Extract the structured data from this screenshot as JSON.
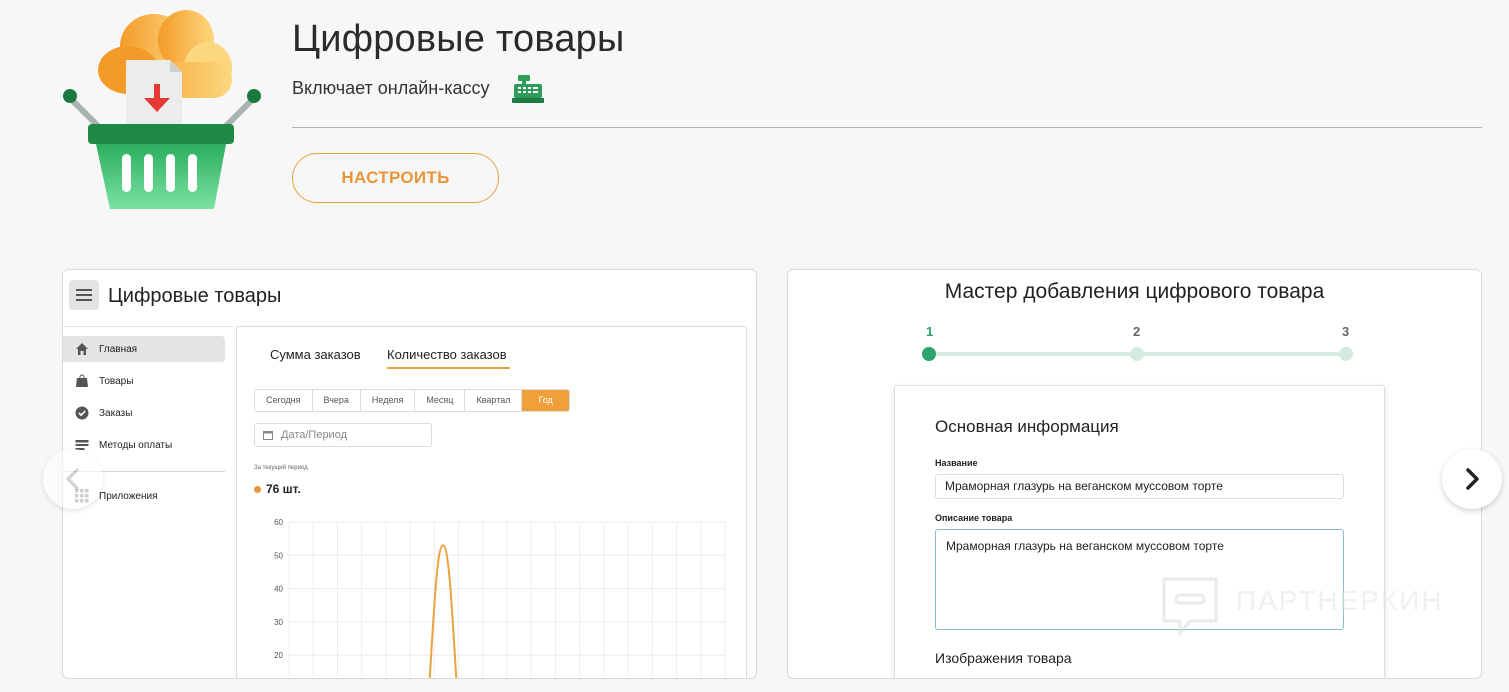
{
  "header": {
    "title": "Цифровые товары",
    "subtitle": "Включает онлайн-кассу",
    "configure_button": "НАСТРОИТЬ",
    "logo_icon": "basket-download-cloud-icon",
    "register_icon": "cash-register-icon",
    "accent_color": "#e8963b"
  },
  "screenshot_1": {
    "title": "Цифровые товары",
    "nav": [
      {
        "label": "Главная",
        "icon": "home-icon",
        "active": true
      },
      {
        "label": "Товары",
        "icon": "bag-icon"
      },
      {
        "label": "Заказы",
        "icon": "check-circle-icon"
      },
      {
        "label": "Методы оплаты",
        "icon": "card-icon"
      }
    ],
    "apps_label": "Приложения",
    "tabs": [
      "Сумма заказов",
      "Количество заказов"
    ],
    "active_tab": "Количество заказов",
    "periods": [
      "Сегодня",
      "Вчера",
      "Неделя",
      "Месяц",
      "Квартал",
      "Год"
    ],
    "active_period": "Год",
    "date_placeholder": "Дата/Период",
    "period_note": "За текущий период",
    "count": "76 шт.",
    "chart_data": {
      "type": "line",
      "y_ticks": [
        60,
        50,
        40,
        30,
        20
      ],
      "ylim": [
        0,
        60
      ],
      "grid": true,
      "series": [
        {
          "color": "#e8a33d",
          "peak_y": 53
        }
      ]
    }
  },
  "screenshot_2": {
    "title": "Мастер добавления цифрового товара",
    "steps": [
      "1",
      "2",
      "3"
    ],
    "active_step": "1",
    "section_title": "Основная информация",
    "name_label": "Название",
    "name_value": "Мраморная глазурь на веганском муссовом торте",
    "description_label": "Описание товара",
    "description_value": "Мраморная глазурь на веганском муссовом торте",
    "images_label": "Изображения товара"
  },
  "watermark": "ПАРТНЕРКИН",
  "carousel": {
    "prev_icon": "chevron-left-icon",
    "next_icon": "chevron-right-icon"
  }
}
